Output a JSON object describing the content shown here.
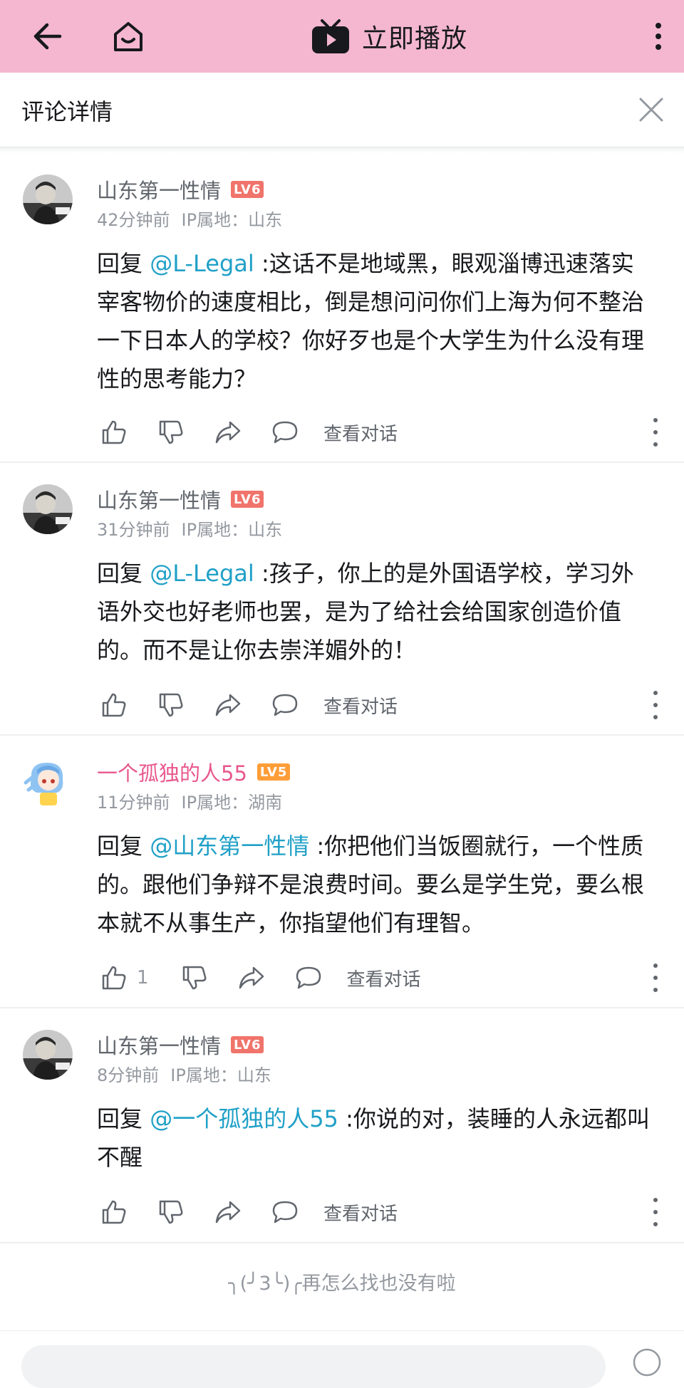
{
  "topbar": {
    "play_label": "立即播放"
  },
  "subheader": {
    "title": "评论详情"
  },
  "comments": [
    {
      "username": "山东第一性情",
      "level": "LV6",
      "time": "42分钟前",
      "ip": "IP属地：山东",
      "reply_prefix": "回复 ",
      "mention": "@L-Legal",
      "text": " :这话不是地域黑，眼观淄博迅速落实宰客物价的速度相比，倒是想问问你们上海为何不整治一下日本人的学校？你好歹也是个大学生为什么没有理性的思考能力？",
      "likes": "",
      "view_conversation": "查看对话"
    },
    {
      "username": "山东第一性情",
      "level": "LV6",
      "time": "31分钟前",
      "ip": "IP属地：山东",
      "reply_prefix": "回复 ",
      "mention": "@L-Legal",
      "text": " :孩子，你上的是外国语学校，学习外语外交也好老师也罢，是为了给社会给国家创造价值的。而不是让你去崇洋媚外的！",
      "likes": "",
      "view_conversation": "查看对话"
    },
    {
      "username": "一个孤独的人55",
      "level": "LV5",
      "time": "11分钟前",
      "ip": "IP属地：湖南",
      "reply_prefix": "回复 ",
      "mention": "@山东第一性情",
      "text": " :你把他们当饭圈就行，一个性质的。跟他们争辩不是浪费时间。要么是学生党，要么根本就不从事生产，你指望他们有理智。",
      "likes": "1",
      "view_conversation": "查看对话"
    },
    {
      "username": "山东第一性情",
      "level": "LV6",
      "time": "8分钟前",
      "ip": "IP属地：山东",
      "reply_prefix": "回复 ",
      "mention": "@一个孤独的人55",
      "text": " :你说的对，装睡的人永远都叫不醒",
      "likes": "",
      "view_conversation": "查看对话"
    }
  ],
  "end_tip": "╮(╯3╰)╭再怎么找也没有啦",
  "colors": {
    "topbar_bg": "#f4b7cf",
    "mention": "#20a0c7",
    "vip_name": "#e8578d",
    "level6": "#f0746b",
    "level5": "#ff9d37"
  },
  "icons": [
    "back-arrow-icon",
    "home-icon",
    "tv-play-icon",
    "more-vertical-icon",
    "close-icon",
    "thumb-up-icon",
    "thumb-down-icon",
    "share-icon",
    "comment-bubble-icon"
  ]
}
